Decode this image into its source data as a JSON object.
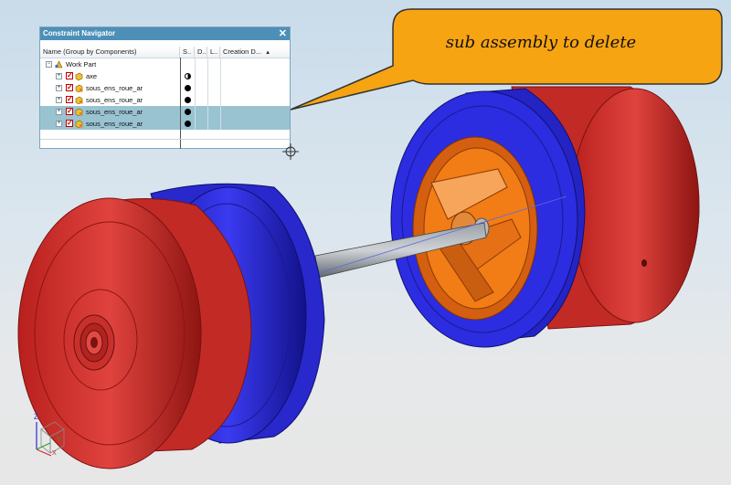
{
  "navigator": {
    "title": "Constraint Navigator",
    "close_glyph": "✕",
    "columns": [
      "Name (Group by Components)",
      "S..",
      "D..",
      "L..",
      "Creation D..."
    ],
    "sort_glyph": "▲",
    "root": {
      "label": "Work Part",
      "expander": "−"
    },
    "rows": [
      {
        "label": "axe",
        "status": "half",
        "selected": false
      },
      {
        "label": "sous_ens_roue_ar",
        "status": "full",
        "selected": false
      },
      {
        "label": "sous_ens_roue_ar",
        "status": "full",
        "selected": false
      },
      {
        "label": "sous_ens_roue_ar",
        "status": "full",
        "selected": true
      },
      {
        "label": "sous_ens_roue_ar",
        "status": "full",
        "selected": true
      }
    ]
  },
  "callout": {
    "text": "sub assembly to delete",
    "fill": "#f7a412"
  },
  "triad": {
    "z": "Z",
    "y": "Y",
    "x": "X"
  },
  "colors": {
    "red": "#d6312e",
    "blue": "#2929d6",
    "orange": "#f27c15",
    "header": "#4d8fb7"
  }
}
